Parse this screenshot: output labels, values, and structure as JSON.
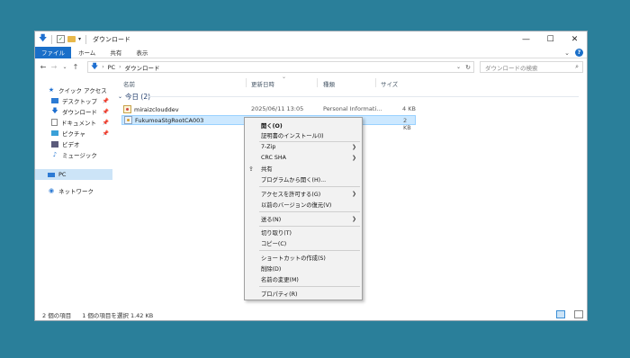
{
  "window": {
    "title": "ダウンロード",
    "controls": {
      "minimize": "—",
      "maximize": "☐",
      "close": "✕"
    }
  },
  "ribbon": {
    "tabs": [
      "ファイル",
      "ホーム",
      "共有",
      "表示"
    ]
  },
  "address": {
    "path": [
      "PC",
      "ダウンロード"
    ],
    "search_placeholder": "ダウンロードの検索"
  },
  "navpane": {
    "quick_access": "クイック アクセス",
    "items": [
      {
        "label": "デスクトップ",
        "icon": "desktop-icon"
      },
      {
        "label": "ダウンロード",
        "icon": "download-icon"
      },
      {
        "label": "ドキュメント",
        "icon": "document-icon"
      },
      {
        "label": "ピクチャ",
        "icon": "picture-icon"
      },
      {
        "label": "ビデオ",
        "icon": "video-icon"
      },
      {
        "label": "ミュージック",
        "icon": "music-icon"
      }
    ],
    "pc": "PC",
    "network": "ネットワーク"
  },
  "columns": {
    "name": "名前",
    "date": "更新日時",
    "type": "種類",
    "size": "サイズ"
  },
  "group": {
    "label": "今日 (2)"
  },
  "files": [
    {
      "name": "miraizclouddev",
      "date": "2025/06/11 13:05",
      "type": "Personal Informati...",
      "size": "4 KB"
    },
    {
      "name": "FukumoaStgRootCA003",
      "date": "",
      "type": "",
      "size": "2 KB"
    }
  ],
  "context_menu": {
    "items": [
      {
        "label": "開く(O)"
      },
      {
        "label": "証明書のインストール(I)"
      },
      {
        "label": "7-Zip"
      },
      {
        "label": "CRC SHA"
      },
      {
        "label": "共有"
      },
      {
        "label": "プログラムから開く(H)..."
      },
      {
        "label": "アクセスを許可する(G)"
      },
      {
        "label": "以前のバージョンの復元(V)"
      },
      {
        "label": "送る(N)"
      },
      {
        "label": "切り取り(T)"
      },
      {
        "label": "コピー(C)"
      },
      {
        "label": "ショートカットの作成(S)"
      },
      {
        "label": "削除(D)"
      },
      {
        "label": "名前の変更(M)"
      },
      {
        "label": "プロパティ(R)"
      }
    ]
  },
  "status": {
    "count": "2 個の項目",
    "selected": "1 個の項目を選択 1.42 KB"
  },
  "colors": {
    "accent": "#1a6fc9",
    "selection": "#cce8ff",
    "desktop": "#2a7f9a"
  }
}
